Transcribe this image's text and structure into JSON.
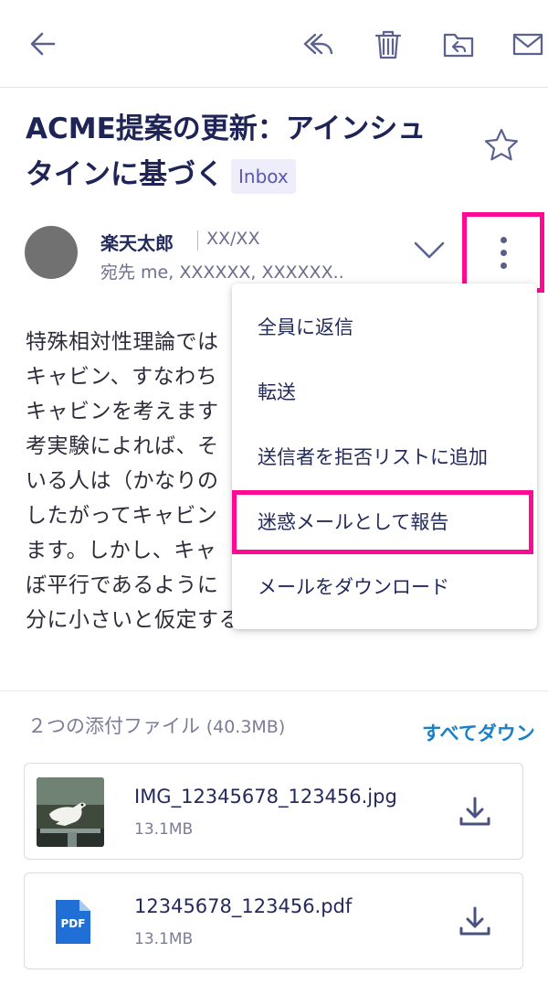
{
  "toolbar": {
    "back": "back-arrow-icon",
    "reply": "reply-icon",
    "delete": "trash-icon",
    "move": "folder-move-icon",
    "mail": "envelope-icon"
  },
  "email": {
    "subject_line1": "ACME提案の更新：アインシュ",
    "subject_line2": "タインに基づく",
    "folder_badge": "Inbox",
    "sender_name": "楽天太郎",
    "date": "XX/XX",
    "recipients": "宛先 me, XXXXXX,  XXXXXX..",
    "body_lines": [
      "特殊相対性理論では",
      "キャビン、すなわち",
      "キャビンを考えます",
      "考実験によれば、そ",
      "いる人は（かなりの",
      "したがってキャビン",
      "ます。しかし、キャ",
      "ぼ平行であるように",
      "分に小さいと仮定する必要があります。"
    ]
  },
  "menu": {
    "items": [
      "全員に返信",
      "転送",
      "送信者を拒否リストに追加",
      "迷惑メールとして報告",
      "メールをダウンロード"
    ],
    "highlighted_index": 3
  },
  "attachments": {
    "count_label": "２つの添付ファイル",
    "total_size": "(40.3MB)",
    "download_all": "すべてダウン",
    "files": [
      {
        "name": "IMG_12345678_123456.jpg",
        "size": "13.1MB",
        "type": "image"
      },
      {
        "name": "12345678_123456.pdf",
        "size": "13.1MB",
        "type": "pdf",
        "icon_label": "PDF"
      }
    ]
  },
  "colors": {
    "accent_highlight": "#ff0a94",
    "link": "#1a80c8",
    "text_primary": "#232a5c",
    "pdf_blue": "#1f6fd6"
  }
}
